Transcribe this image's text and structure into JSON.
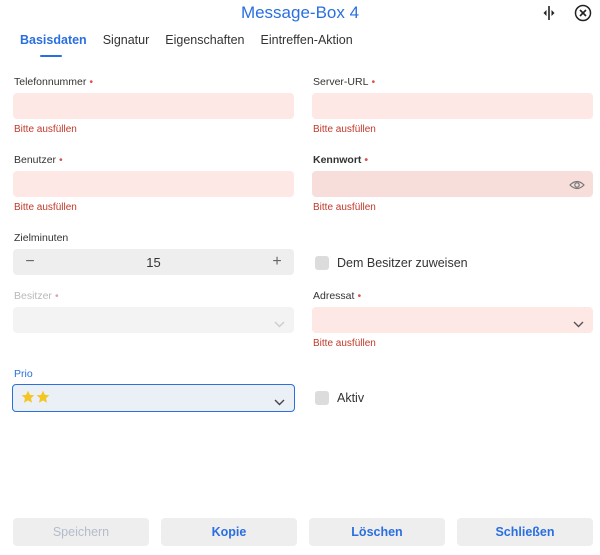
{
  "window": {
    "title": "Message-Box 4"
  },
  "header": {
    "split_icon": "split-columns-icon",
    "close_icon": "close-circle-icon"
  },
  "tabs": [
    {
      "label": "Basisdaten",
      "active": true
    },
    {
      "label": "Signatur",
      "active": false
    },
    {
      "label": "Eigenschaften",
      "active": false
    },
    {
      "label": "Eintreffen-Aktion",
      "active": false
    }
  ],
  "form": {
    "required_marker": "•",
    "error_text": "Bitte ausfüllen",
    "telefonnummer": {
      "label": "Telefonnummer",
      "value": ""
    },
    "server_url": {
      "label": "Server-URL",
      "value": ""
    },
    "benutzer": {
      "label": "Benutzer",
      "value": ""
    },
    "kennwort": {
      "label": "Kennwort",
      "value": ""
    },
    "zielminuten": {
      "label": "Zielminuten",
      "value": "15",
      "minus": "−",
      "plus": "+"
    },
    "dem_besitzer_zuweisen": {
      "label": "Dem Besitzer zuweisen",
      "checked": false
    },
    "besitzer": {
      "label": "Besitzer",
      "value": "",
      "disabled": true
    },
    "adressat": {
      "label": "Adressat",
      "value": ""
    },
    "prio": {
      "label": "Prio",
      "stars": 2
    },
    "aktiv": {
      "label": "Aktiv",
      "checked": false
    }
  },
  "buttons": {
    "speichern": "Speichern",
    "kopie": "Kopie",
    "loeschen": "Löschen",
    "schliessen": "Schließen"
  },
  "colors": {
    "accent": "#2a6fe0",
    "error": "#c0392b",
    "error_field": "#fde8e6",
    "star": "#f3c623"
  }
}
